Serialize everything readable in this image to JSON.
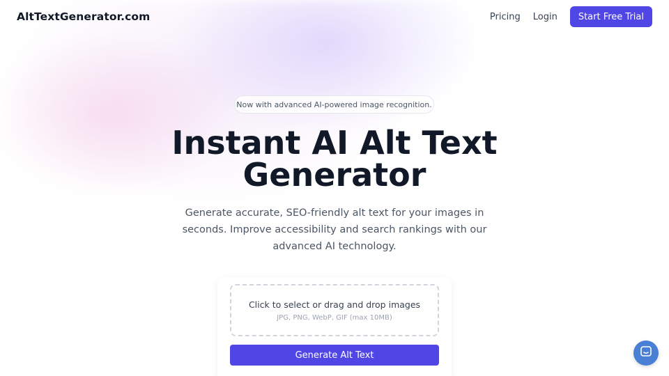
{
  "header": {
    "logo": "AltTextGenerator.com",
    "nav": {
      "pricing": "Pricing",
      "login": "Login",
      "cta": "Start Free Trial"
    }
  },
  "hero": {
    "badge": "Now with advanced AI-powered image recognition.",
    "title_line1": "Instant AI Alt Text",
    "title_line2": "Generator",
    "subtitle": "Generate accurate, SEO-friendly alt text for your images in seconds. Improve accessibility and search rankings with our advanced AI technology."
  },
  "upload": {
    "prompt": "Click to select or drag and drop images",
    "hint": "JPG, PNG, WebP, GIF (max 10MB)",
    "button": "Generate Alt Text"
  },
  "colors": {
    "accent": "#4f46e5",
    "chat": "#4a7fd6"
  },
  "icons": {
    "chat": "chat-bubble-icon"
  }
}
